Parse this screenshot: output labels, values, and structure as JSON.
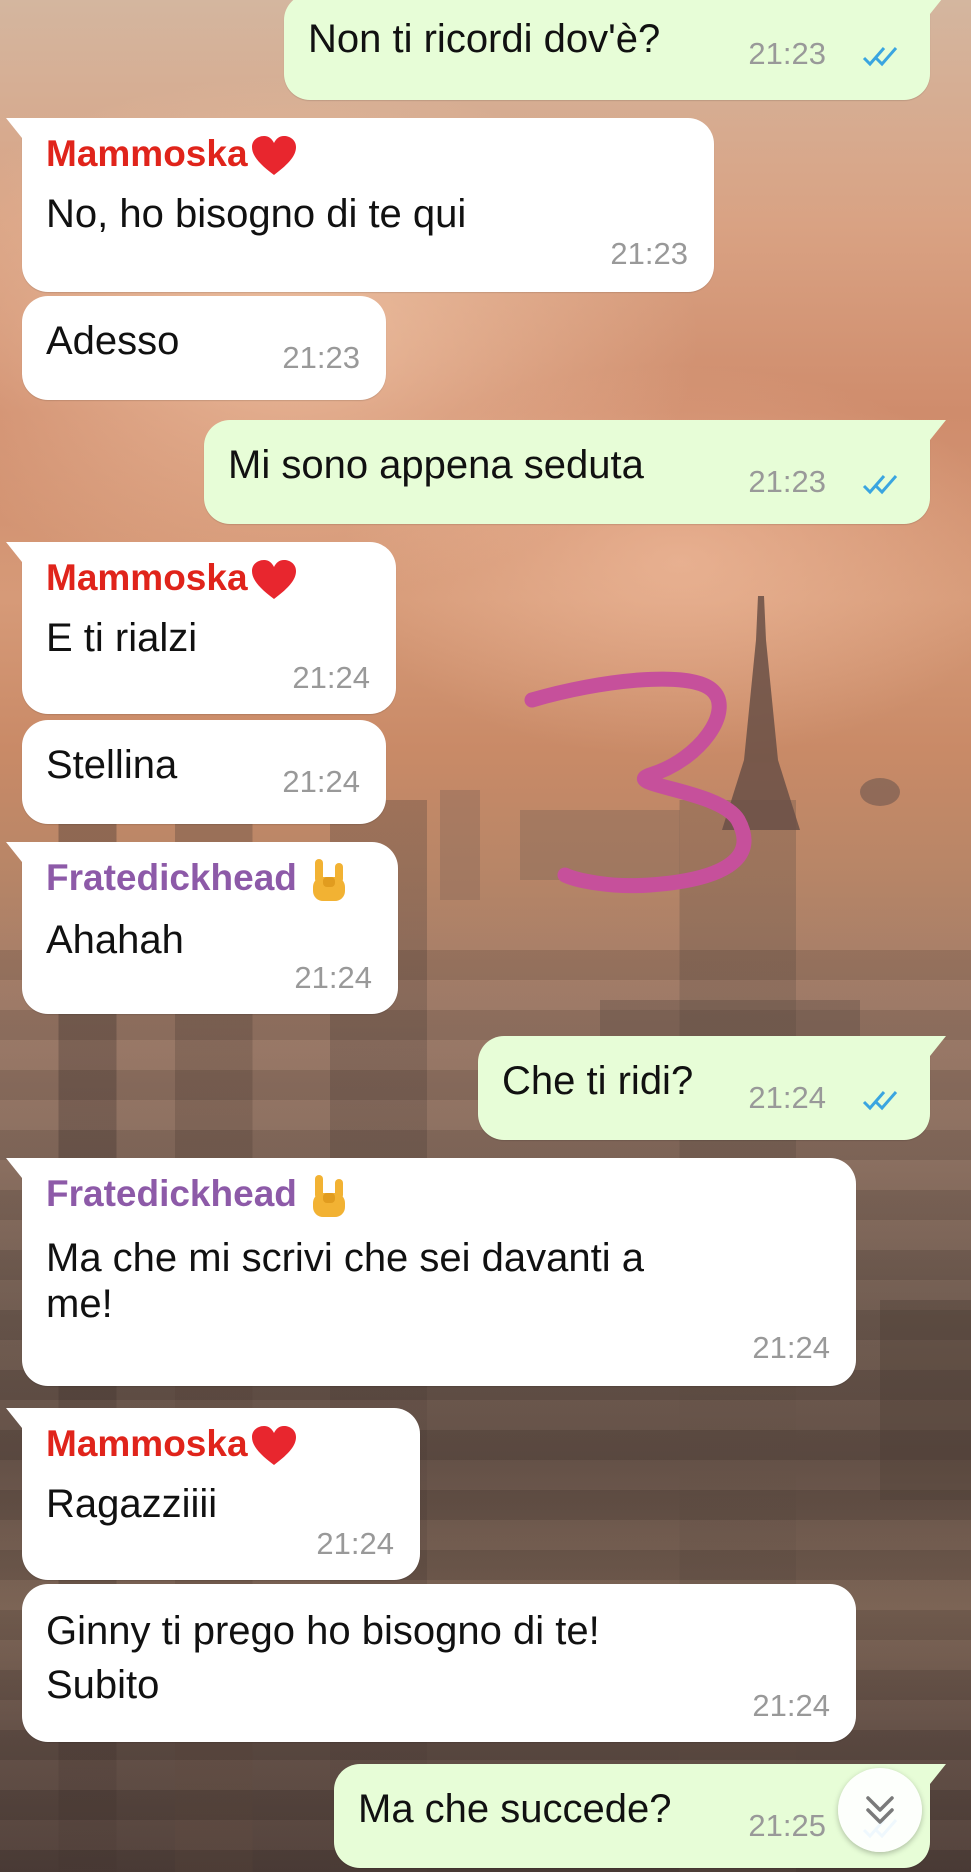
{
  "colors": {
    "incoming_bubble": "#ffffff",
    "outgoing_bubble": "#e7fdd7",
    "timestamp": "#999999",
    "read_ticks": "#3aa5e0",
    "sender_mammoska": "#e0241b",
    "sender_fratedickhead": "#8d5aa8",
    "doodle": "#c6509b"
  },
  "doodle_text": "3",
  "messages": [
    {
      "direction": "out",
      "text": "Non ti ricordi dov'è?",
      "time": "21:23",
      "status": "read"
    },
    {
      "direction": "in",
      "sender": "Mammoska",
      "sender_emoji": "red-heart",
      "text": "No, ho bisogno di te qui",
      "time": "21:23"
    },
    {
      "direction": "in",
      "text": "Adesso",
      "time": "21:23"
    },
    {
      "direction": "out",
      "text": "Mi sono appena seduta",
      "time": "21:23",
      "status": "read"
    },
    {
      "direction": "in",
      "sender": "Mammoska",
      "sender_emoji": "red-heart",
      "text": "E ti rialzi",
      "time": "21:24"
    },
    {
      "direction": "in",
      "text": "Stellina",
      "time": "21:24"
    },
    {
      "direction": "in",
      "sender": "Fratedickhead",
      "sender_emoji": "sign-of-the-horns",
      "text": "Ahahah",
      "time": "21:24"
    },
    {
      "direction": "out",
      "text": "Che ti ridi?",
      "time": "21:24",
      "status": "read"
    },
    {
      "direction": "in",
      "sender": "Fratedickhead",
      "sender_emoji": "sign-of-the-horns",
      "text_lines": [
        "Ma che mi scrivi che sei davanti a",
        "me!"
      ],
      "time": "21:24"
    },
    {
      "direction": "in",
      "sender": "Mammoska",
      "sender_emoji": "red-heart",
      "text": "Ragazziiii",
      "time": "21:24"
    },
    {
      "direction": "in",
      "text_lines": [
        "Ginny ti prego ho bisogno di te!",
        "Subito"
      ],
      "time": "21:24"
    },
    {
      "direction": "out",
      "text": "Ma che succede?",
      "time": "21:25",
      "status": "read"
    }
  ],
  "scroll_button": {
    "icon": "double-chevron-down-icon"
  }
}
